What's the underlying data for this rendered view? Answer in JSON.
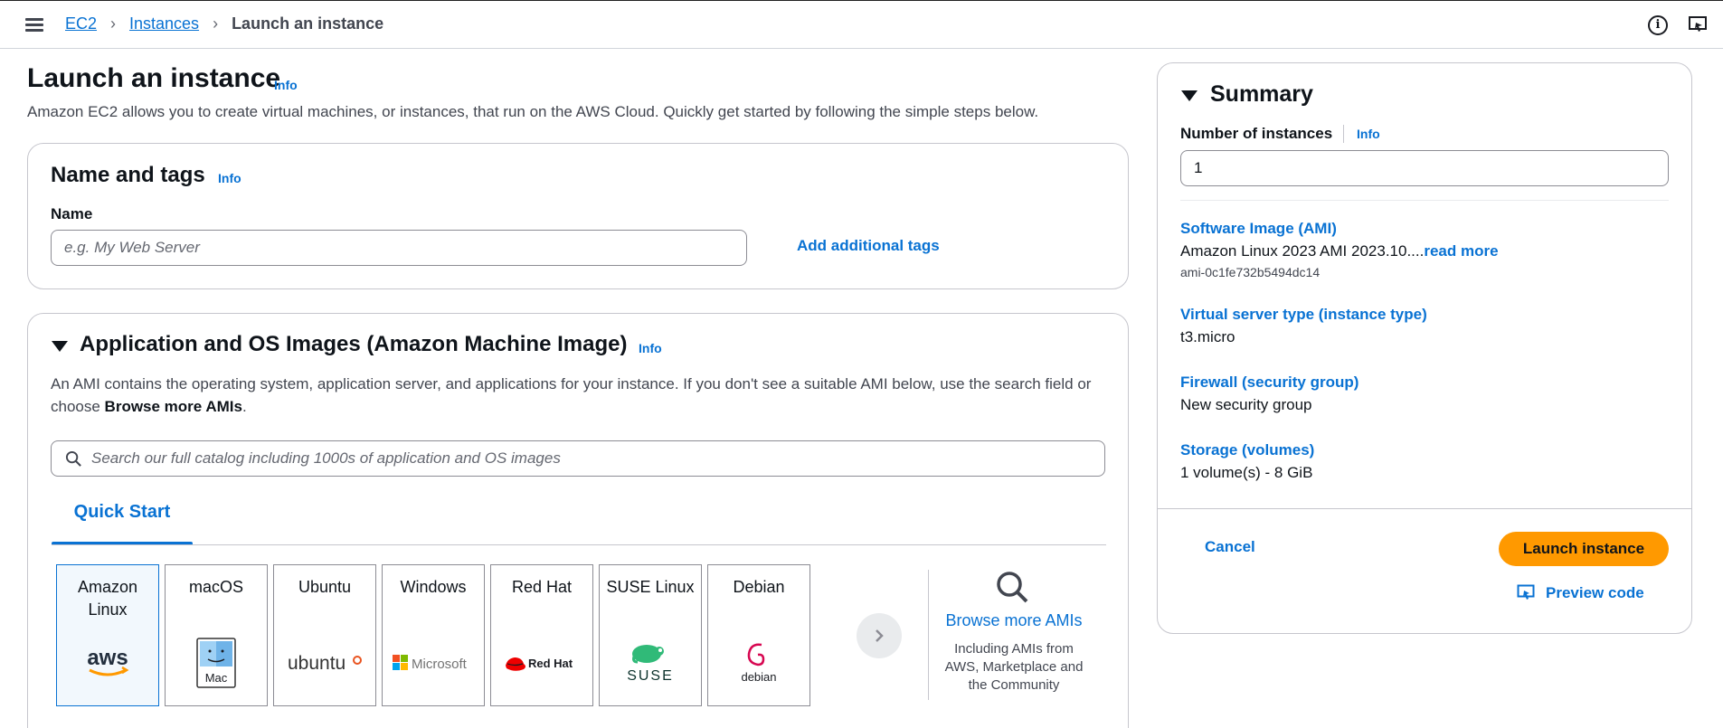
{
  "breadcrumb": {
    "items": [
      "EC2",
      "Instances"
    ],
    "current": "Launch an instance"
  },
  "page": {
    "title": "Launch an instance",
    "info": "Info",
    "description": "Amazon EC2 allows you to create virtual machines, or instances, that run on the AWS Cloud. Quickly get started by following the simple steps below."
  },
  "name_tags": {
    "title": "Name and tags",
    "info": "Info",
    "name_label": "Name",
    "name_placeholder": "e.g. My Web Server",
    "name_value": "",
    "add_tags": "Add additional tags"
  },
  "ami": {
    "title": "Application and OS Images (Amazon Machine Image)",
    "info": "Info",
    "desc_part1": "An AMI contains the operating system, application server, and applications for your instance. If you don't see a suitable AMI below, use the search field or choose ",
    "desc_bold": "Browse more AMIs",
    "desc_end": ".",
    "search_placeholder": "Search our full catalog including 1000s of application and OS images",
    "tab": "Quick Start",
    "tiles": [
      {
        "name": "Amazon Linux",
        "logo": "aws-logo",
        "logo_text": "aws",
        "selected": true
      },
      {
        "name": "macOS",
        "logo": "mac-logo",
        "logo_text": "Mac",
        "selected": false
      },
      {
        "name": "Ubuntu",
        "logo": "ubuntu-logo",
        "logo_text": "ubuntu",
        "selected": false
      },
      {
        "name": "Windows",
        "logo": "microsoft-logo",
        "logo_text": "Microsoft",
        "selected": false
      },
      {
        "name": "Red Hat",
        "logo": "redhat-logo",
        "logo_text": "Red Hat",
        "selected": false
      },
      {
        "name": "SUSE Linux",
        "logo": "suse-logo",
        "logo_text": "SUSE",
        "selected": false
      },
      {
        "name": "Debian",
        "logo": "debian-logo",
        "logo_text": "debian",
        "selected": false
      }
    ],
    "browse_link": "Browse more AMIs",
    "browse_sub": "Including AMIs from AWS, Marketplace and the Community"
  },
  "summary": {
    "title": "Summary",
    "num_label": "Number of instances",
    "num_info": "Info",
    "num_value": "1",
    "ami_label": "Software Image (AMI)",
    "ami_value": "Amazon Linux 2023 AMI 2023.10....",
    "ami_read_more": "read more",
    "ami_id": "ami-0c1fe732b5494dc14",
    "type_label": "Virtual server type (instance type)",
    "type_value": "t3.micro",
    "fw_label": "Firewall (security group)",
    "fw_value": "New security group",
    "storage_label": "Storage (volumes)",
    "storage_value": "1 volume(s) - 8 GiB",
    "cancel": "Cancel",
    "launch": "Launch instance",
    "preview": "Preview code"
  },
  "colors": {
    "link": "#0972d3",
    "primary_button": "#ff9900",
    "text": "#0f141a"
  }
}
